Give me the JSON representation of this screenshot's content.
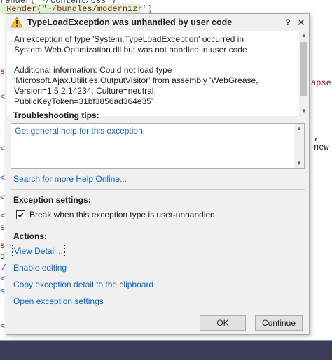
{
  "editor": {
    "line1": "render(\"~/Content/css\")",
    "line2": ".Render(\"~/bundles/modernizr\")",
    "gutter": [
      "s",
      "<",
      "<",
      "<",
      "<",
      "<",
      "s",
      "s",
      "d",
      "/",
      "<",
      "<",
      "<"
    ],
    "right_frag_1": "apse\"",
    "right_frag_2": "new"
  },
  "dialog": {
    "title": "TypeLoadException was unhandled by user code",
    "help_glyph": "?",
    "close_glyph": "✕",
    "message_line1": "An exception of type 'System.TypeLoadException' occurred in",
    "message_line2": "System.Web.Optimization.dll but was not handled in user code",
    "additional_line1": "Additional information: Could not load type",
    "additional_line2": "'Microsoft.Ajax.Utilities.OutputVisitor' from assembly 'WebGrease,",
    "additional_line3": "Version=1.5.2.14234, Culture=neutral, PublicKeyToken=31bf3856ad364e35'",
    "troubleshooting_label": "Troubleshooting tips:",
    "tips_link": "Get general help for this exception.",
    "search_help_link": "Search for more Help Online...",
    "exception_settings_label": "Exception settings:",
    "break_checkbox_label": "Break when this exception type is user-unhandled",
    "break_checked": true,
    "actions_label": "Actions:",
    "actions": [
      "View Detail...",
      "Enable editing",
      "Copy exception detail to the clipboard",
      "Open exception settings"
    ],
    "ok_label": "OK",
    "continue_label": "Continue"
  },
  "colors": {
    "link": "#0b63c5",
    "warning": "#f5c211",
    "taskbar": "#3c3d5a"
  },
  "icons": {
    "title_icon": "warning-icon"
  }
}
